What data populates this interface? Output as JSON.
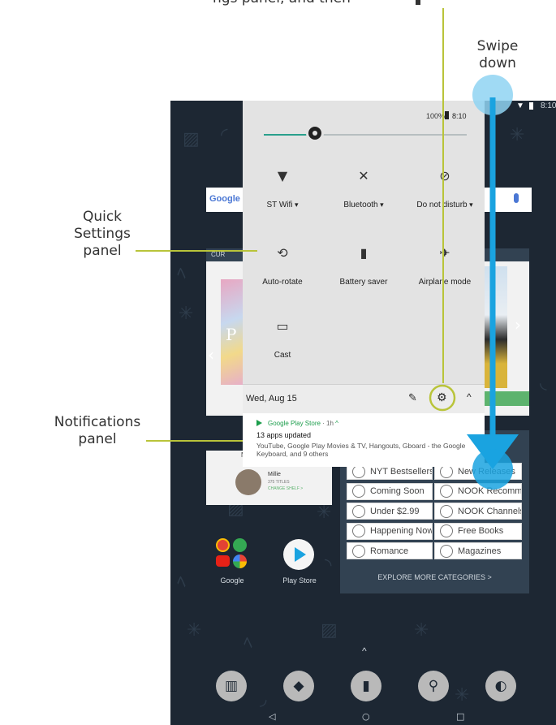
{
  "annotations": {
    "top_fragment": "ngs panel, and then",
    "swipe": [
      "Swipe",
      "down"
    ],
    "quick_settings": [
      "Quick",
      "Settings",
      "panel"
    ],
    "notifications": [
      "Notifications",
      "panel"
    ]
  },
  "status_bar": {
    "time": "8:10",
    "battery": "100%"
  },
  "home": {
    "search_logo": "Google",
    "carousel_label": "CUR",
    "book_badge": "P",
    "card_title": "Millie",
    "card_sub": "375 TITLES",
    "card_link": "CHANGE SHELF >",
    "categories": [
      {
        "label": "NYT Bestsellers"
      },
      {
        "label": "New Releases"
      },
      {
        "label": "Coming Soon"
      },
      {
        "label": "NOOK Recommends"
      },
      {
        "label": "Under $2.99"
      },
      {
        "label": "NOOK Channels"
      },
      {
        "label": "Happening Now"
      },
      {
        "label": "Free Books"
      },
      {
        "label": "Romance"
      },
      {
        "label": "Magazines"
      }
    ],
    "explore": "EXPLORE MORE CATEGORIES >",
    "apps": [
      {
        "label": "Google"
      },
      {
        "label": "Play Store"
      }
    ],
    "nav": {
      "back": "◁",
      "home": "○",
      "recents": "□"
    },
    "up_caret": "^"
  },
  "quick_settings": {
    "status_battery": "100%",
    "status_time": "8:10",
    "brightness_level": 0.25,
    "tiles": [
      {
        "label": "ST Wifi",
        "icon": "wifi-icon",
        "dropdown": true
      },
      {
        "label": "Bluetooth",
        "icon": "bluetooth-off-icon",
        "dropdown": true
      },
      {
        "label": "Do not disturb",
        "icon": "do-not-disturb-off-icon",
        "dropdown": true
      },
      {
        "label": "Auto-rotate",
        "icon": "auto-rotate-icon",
        "dropdown": false
      },
      {
        "label": "Battery saver",
        "icon": "battery-saver-icon",
        "dropdown": false
      },
      {
        "label": "Airplane mode",
        "icon": "airplane-off-icon",
        "dropdown": false
      },
      {
        "label": "Cast",
        "icon": "cast-icon",
        "dropdown": false
      }
    ],
    "date": "Wed, Aug 15"
  },
  "notification": {
    "app": "Google Play Store",
    "age": "1h",
    "title": "13 apps updated",
    "body": "YouTube, Google Play Movies & TV, Hangouts, Gboard - the Google Keyboard, and 9 others"
  },
  "colors": {
    "screen": "#1d2733",
    "accent": "#b9c43a",
    "swipe": "#1aa3e0",
    "qs": "#e3e3e3"
  }
}
